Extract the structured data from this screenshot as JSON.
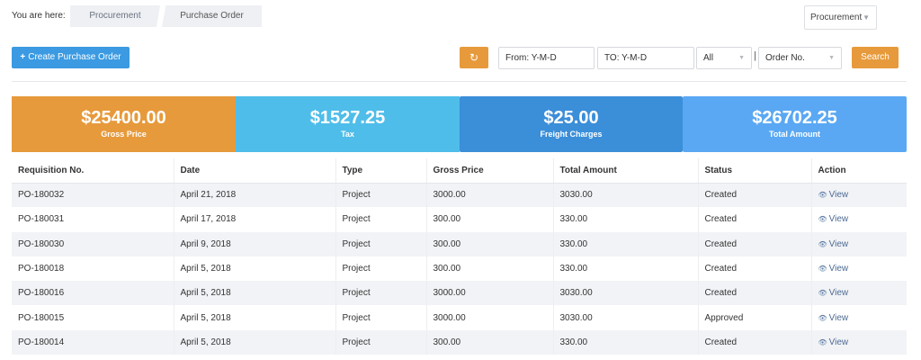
{
  "breadcrumb": {
    "lead": "You are here:",
    "items": [
      "Procurement",
      "Purchase Order"
    ]
  },
  "module_select": {
    "value": "Procurement",
    "icon": "chevron-down-icon"
  },
  "toolbar": {
    "create_label": "Create Purchase Order",
    "create_icon": "+",
    "refresh_icon": "refresh-icon",
    "from_value": "From: Y-M-D",
    "to_value": "TO: Y-M-D",
    "all_value": "All",
    "separator": "|",
    "order_value": "Order No.",
    "search_label": "Search"
  },
  "summary": [
    {
      "amount": "$25400.00",
      "label": "Gross Price",
      "color": "#e79a3b"
    },
    {
      "amount": "$1527.25",
      "label": "Tax",
      "color": "#4fbde9"
    },
    {
      "amount": "$25.00",
      "label": "Freight Charges",
      "color": "#3b8ed8"
    },
    {
      "amount": "$26702.25",
      "label": "Total Amount",
      "color": "#5aa8f3"
    }
  ],
  "table": {
    "headers": [
      "Requisition No.",
      "Date",
      "Type",
      "Gross Price",
      "Total Amount",
      "Status",
      "Action"
    ],
    "rows": [
      [
        "PO-180032",
        "April 21, 2018",
        "Project",
        "3000.00",
        "3030.00",
        "Created",
        "View"
      ],
      [
        "PO-180031",
        "April 17, 2018",
        "Project",
        "300.00",
        "330.00",
        "Created",
        "View"
      ],
      [
        "PO-180030",
        "April 9, 2018",
        "Project",
        "300.00",
        "330.00",
        "Created",
        "View"
      ],
      [
        "PO-180018",
        "April 5, 2018",
        "Project",
        "300.00",
        "330.00",
        "Created",
        "View"
      ],
      [
        "PO-180016",
        "April 5, 2018",
        "Project",
        "3000.00",
        "3030.00",
        "Created",
        "View"
      ],
      [
        "PO-180015",
        "April 5, 2018",
        "Project",
        "3000.00",
        "3030.00",
        "Approved",
        "View"
      ],
      [
        "PO-180014",
        "April 5, 2018",
        "Project",
        "300.00",
        "330.00",
        "Created",
        "View"
      ]
    ]
  },
  "colors": {
    "primary": "#3b9ae1",
    "accent": "#e79a3b",
    "link": "#4d6b94"
  }
}
